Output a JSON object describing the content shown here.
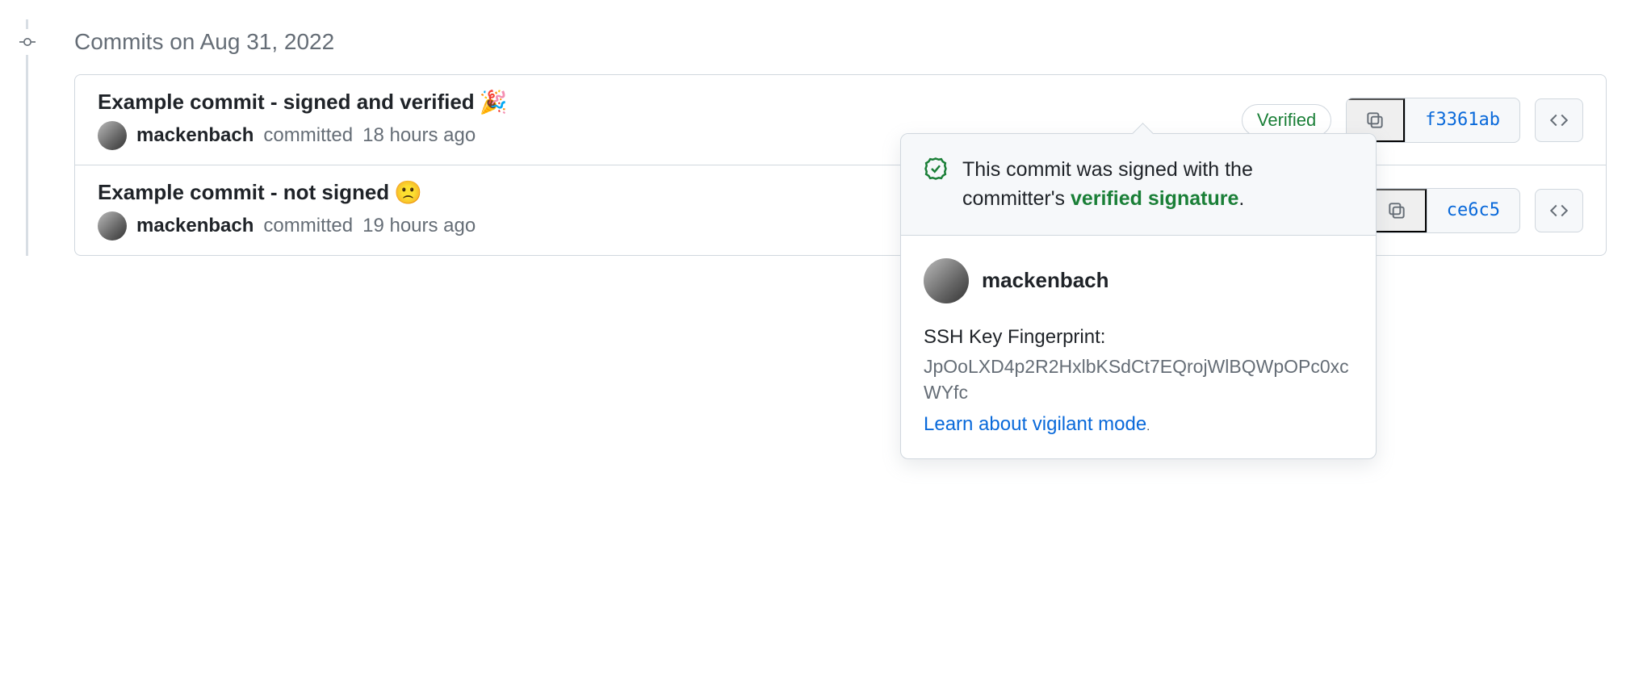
{
  "group_title": "Commits on Aug 31, 2022",
  "commits": [
    {
      "title": "Example commit - signed and verified",
      "emoji": "🎉",
      "author": "mackenbach",
      "meta_action": "committed",
      "meta_time": "18 hours ago",
      "verified_label": "Verified",
      "sha": "f3361ab"
    },
    {
      "title": "Example commit - not signed",
      "emoji": "🙁",
      "author": "mackenbach",
      "meta_action": "committed",
      "meta_time": "19 hours ago",
      "verified_label": "",
      "sha": "ce6c5"
    }
  ],
  "popover": {
    "header_prefix": "This commit was signed with the committer's ",
    "header_green": "verified signature",
    "header_suffix": ".",
    "username": "mackenbach",
    "fp_label": "SSH Key Fingerprint:",
    "fp_value": "JpOoLXD4p2R2HxlbKSdCt7EQrojWlBQWpOPc0xcWYfc",
    "learn_text": "Learn about vigilant mode",
    "learn_suffix": "."
  }
}
